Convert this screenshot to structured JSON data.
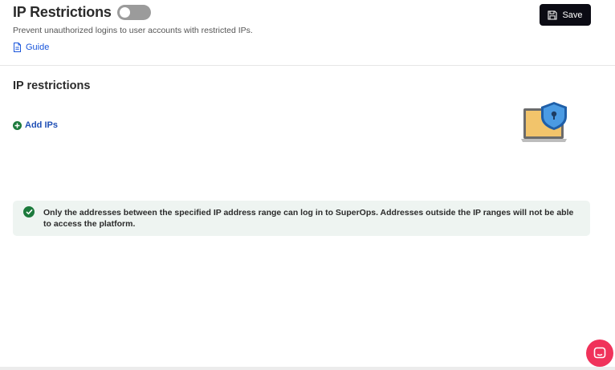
{
  "header": {
    "title": "IP Restrictions",
    "toggle_on": false,
    "subtitle": "Prevent unauthorized logins to user accounts with restricted IPs.",
    "guide_label": "Guide",
    "save_label": "Save"
  },
  "section": {
    "title": "IP restrictions",
    "add_label": "Add IPs"
  },
  "info": {
    "text": "Only the addresses between the specified IP address range can log in to SuperOps. Addresses outside the IP ranges will not be able to access the platform."
  },
  "icons": {
    "guide": "document-icon",
    "save": "floppy-disk-icon",
    "add": "plus-circle-icon",
    "info": "check-circle-icon",
    "illustration": "laptop-shield-lock-icon",
    "chat": "chat-icon"
  },
  "colors": {
    "primary_dark": "#0b0b14",
    "link_blue": "#1a56db",
    "success_green": "#1c7a3c",
    "info_bg": "#eef4f1",
    "chat_pink": "#f0325a",
    "toggle_off": "#9b9b9b"
  }
}
